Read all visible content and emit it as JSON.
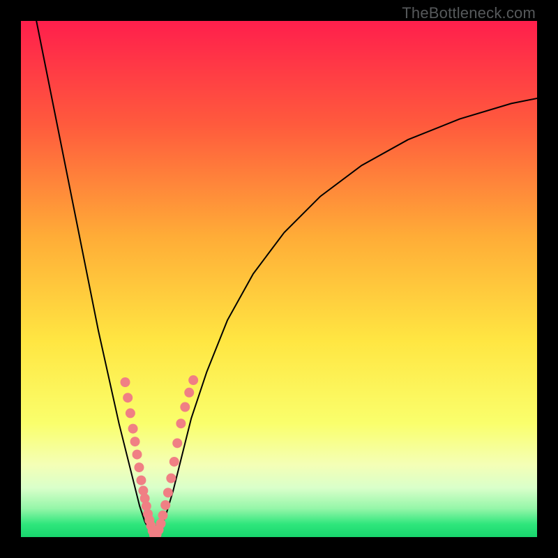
{
  "watermark": "TheBottleneck.com",
  "chart_data": {
    "type": "line",
    "title": "",
    "xlabel": "",
    "ylabel": "",
    "xlim": [
      0,
      100
    ],
    "ylim": [
      0,
      100
    ],
    "grid": false,
    "background_gradient_stops": [
      {
        "offset": 0.0,
        "color": "#ff1f4c"
      },
      {
        "offset": 0.2,
        "color": "#ff5a3d"
      },
      {
        "offset": 0.42,
        "color": "#ffad37"
      },
      {
        "offset": 0.62,
        "color": "#ffe642"
      },
      {
        "offset": 0.78,
        "color": "#faff6c"
      },
      {
        "offset": 0.86,
        "color": "#f4ffb6"
      },
      {
        "offset": 0.905,
        "color": "#d9ffca"
      },
      {
        "offset": 0.945,
        "color": "#94f6a8"
      },
      {
        "offset": 0.975,
        "color": "#2fe67c"
      },
      {
        "offset": 1.0,
        "color": "#18d66d"
      }
    ],
    "series": [
      {
        "name": "bottleneck-curve-left",
        "type": "line",
        "x": [
          3,
          5,
          7,
          9,
          11,
          13,
          15,
          17,
          19,
          20.5,
          22,
          23,
          24,
          24.8,
          25.4,
          26
        ],
        "y": [
          100,
          90,
          80,
          70,
          60,
          50,
          40,
          31,
          22,
          16,
          10,
          6,
          3,
          1.5,
          0.5,
          0
        ]
      },
      {
        "name": "bottleneck-curve-right",
        "type": "line",
        "x": [
          26,
          27,
          28,
          29.5,
          31,
          33,
          36,
          40,
          45,
          51,
          58,
          66,
          75,
          85,
          95,
          100
        ],
        "y": [
          0,
          1.5,
          4,
          9,
          15,
          23,
          32,
          42,
          51,
          59,
          66,
          72,
          77,
          81,
          84,
          85
        ]
      },
      {
        "name": "left-branch-markers",
        "type": "scatter",
        "marker_color": "#f07f84",
        "x": [
          20.2,
          20.7,
          21.2,
          21.7,
          22.1,
          22.5,
          22.9,
          23.3,
          23.7,
          24.0,
          24.3,
          24.6,
          24.9,
          25.2,
          25.5,
          25.8
        ],
        "y": [
          30.0,
          27.0,
          24.0,
          21.0,
          18.5,
          16.0,
          13.5,
          11.0,
          9.0,
          7.5,
          6.0,
          4.5,
          3.3,
          2.2,
          1.2,
          0.4
        ]
      },
      {
        "name": "right-branch-markers",
        "type": "scatter",
        "marker_color": "#f07f84",
        "x": [
          26.3,
          26.7,
          27.1,
          27.5,
          28.0,
          28.5,
          29.1,
          29.7,
          30.3,
          31.0,
          31.8,
          32.6,
          33.4
        ],
        "y": [
          0.5,
          1.4,
          2.6,
          4.2,
          6.2,
          8.6,
          11.4,
          14.6,
          18.2,
          22.0,
          25.2,
          28.0,
          30.4
        ]
      },
      {
        "name": "valley-markers",
        "type": "scatter",
        "marker_color": "#f07f84",
        "x": [
          25.9,
          26.0,
          26.1
        ],
        "y": [
          0.1,
          0.0,
          0.1
        ]
      }
    ]
  }
}
